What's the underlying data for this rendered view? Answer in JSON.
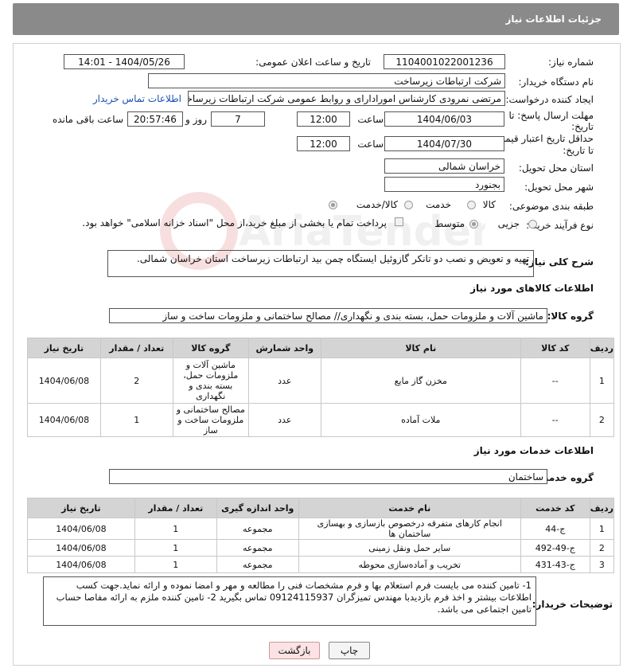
{
  "header": {
    "title": "جزئیات اطلاعات نیاز"
  },
  "watermark": {
    "text": "AriaTender.neT"
  },
  "form": {
    "need_number_label": "شماره نیاز:",
    "need_number": "1104001022001236",
    "announce_label": "تاریخ و ساعت اعلان عمومی:",
    "announce_value": "1404/05/26 - 14:01",
    "buyer_label": "نام دستگاه خریدار:",
    "buyer_value": "شرکت ارتباطات زیرساخت",
    "creator_label": "ایجاد کننده درخواست:",
    "creator_value": "مرتضی نمرودی کارشناس امورادارای و روابط عمومی شرکت ارتباطات زیرساخت",
    "contact_link": "اطلاعات تماس خریدار",
    "deadline_label_1": "مهلت ارسال پاسخ: تا",
    "deadline_label_2": "تاریخ:",
    "deadline_date": "1404/06/03",
    "time_label": "ساعت",
    "deadline_time": "12:00",
    "remaining_days": "7",
    "days_label": "روز و",
    "remaining_time": "20:57:46",
    "remaining_label": "ساعت باقی مانده",
    "validity_label_1": "حداقل تاریخ اعتبار قیمت:",
    "validity_label_2": "تا تاریخ:",
    "validity_date": "1404/07/30",
    "validity_time": "12:00",
    "province_label": "استان محل تحویل:",
    "province_value": "خراسان شمالی",
    "city_label": "شهر محل تحویل:",
    "city_value": "بجنورد",
    "category_label": "طبقه بندی موضوعی:",
    "category_options": [
      "کالا",
      "خدمت",
      "کالا/خدمت"
    ],
    "process_label": "نوع فرآیند خرید :",
    "process_options": [
      "جزیی",
      "متوسط"
    ],
    "payment_note": "پرداخت تمام یا بخشی از مبلغ خرید،از محل \"اسناد خزانه اسلامی\" خواهد بود."
  },
  "description": {
    "label": "شرح کلی نیاز:",
    "value": "تهیه و تعویض و نصب دو تانکر گازوئیل ایستگاه چمن بید ارتباطات زیرساخت استان خراسان شمالی."
  },
  "goods": {
    "section_title": "اطلاعات کالاهای مورد نیاز",
    "group_label": "گروه کالا:",
    "group_value": "ماشین آلات و ملزومات حمل، بسته بندی و نگهداری// مصالح ساختمانی و ملزومات ساخت و ساز",
    "headers": [
      "ردیف",
      "کد کالا",
      "نام کالا",
      "واحد شمارش",
      "گروه کالا",
      "تعداد / مقدار",
      "تاریخ نیاز"
    ],
    "rows": [
      [
        "1",
        "--",
        "مخزن گاز مایع",
        "عدد",
        "ماشین آلات و ملزومات حمل، بسته بندی و نگهداری",
        "2",
        "1404/06/08"
      ],
      [
        "2",
        "--",
        "ملات آماده",
        "عدد",
        "مصالح ساختمانی و ملزومات ساخت و ساز",
        "1",
        "1404/06/08"
      ]
    ]
  },
  "services": {
    "section_title": "اطلاعات خدمات مورد نیاز",
    "group_label": "گروه خدمت:",
    "group_value": "ساختمان",
    "headers": [
      "ردیف",
      "کد خدمت",
      "نام خدمت",
      "واحد اندازه گیری",
      "تعداد / مقدار",
      "تاریخ نیاز"
    ],
    "rows": [
      [
        "1",
        "ج-44",
        "انجام کارهای متفرقه درخصوص بازسازی و بهسازی ساختمان ها",
        "مجموعه",
        "1",
        "1404/06/08"
      ],
      [
        "2",
        "ج-49-492",
        "سایر حمل ونقل زمینی",
        "مجموعه",
        "1",
        "1404/06/08"
      ],
      [
        "3",
        "ج-43-431",
        "تخریب و آماده‌سازی محوطه",
        "مجموعه",
        "1",
        "1404/06/08"
      ]
    ]
  },
  "buyer_notes": {
    "label": "توضیحات خریدار:",
    "value": "1- تامین کننده می بایست فرم استعلام بها و فرم مشخصات فنی را مطالعه و مهر و امضا نموده و ارائه نماید.جهت کسب اطلاعات بیشتر و اخذ فرم بازدیدبا مهندس تمیزگران 09124115937 تماس بگیرید 2- تامین کننده ملزم به ارائه مفاصا حساب تامین اجتماعی می باشد."
  },
  "buttons": {
    "print": "چاپ",
    "back": "بازگشت"
  }
}
